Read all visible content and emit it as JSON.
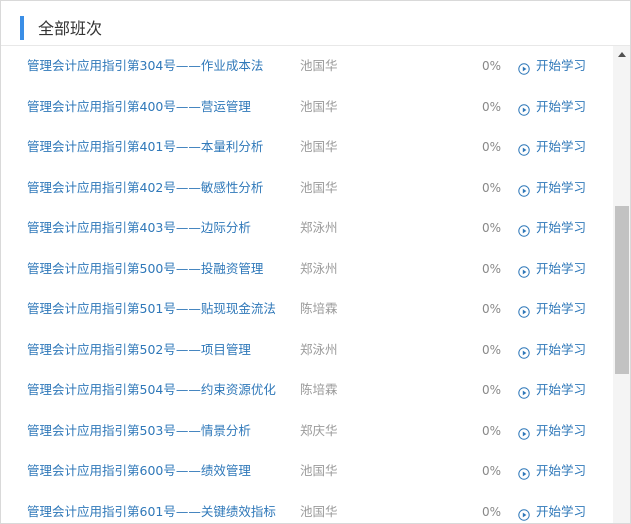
{
  "header": {
    "title": "全部班次"
  },
  "start_label": "开始学习",
  "courses": [
    {
      "name": "管理会计应用指引第304号——作业成本法",
      "teacher": "池国华",
      "progress": "0%"
    },
    {
      "name": "管理会计应用指引第400号——营运管理",
      "teacher": "池国华",
      "progress": "0%"
    },
    {
      "name": "管理会计应用指引第401号——本量利分析",
      "teacher": "池国华",
      "progress": "0%"
    },
    {
      "name": "管理会计应用指引第402号——敏感性分析",
      "teacher": "池国华",
      "progress": "0%"
    },
    {
      "name": "管理会计应用指引第403号——边际分析",
      "teacher": "郑泳州",
      "progress": "0%"
    },
    {
      "name": "管理会计应用指引第500号——投融资管理",
      "teacher": "郑泳州",
      "progress": "0%"
    },
    {
      "name": "管理会计应用指引第501号——贴现现金流法",
      "teacher": "陈培霖",
      "progress": "0%"
    },
    {
      "name": "管理会计应用指引第502号——项目管理",
      "teacher": "郑泳州",
      "progress": "0%"
    },
    {
      "name": "管理会计应用指引第504号——约束资源优化",
      "teacher": "陈培霖",
      "progress": "0%"
    },
    {
      "name": "管理会计应用指引第503号——情景分析",
      "teacher": "郑庆华",
      "progress": "0%"
    },
    {
      "name": "管理会计应用指引第600号——绩效管理",
      "teacher": "池国华",
      "progress": "0%"
    },
    {
      "name": "管理会计应用指引第601号——关键绩效指标",
      "teacher": "池国华",
      "progress": "0%"
    }
  ],
  "colors": {
    "accent": "#3a8ee6",
    "link": "#2f78b9",
    "muted": "#9a9a9a"
  },
  "icons": {
    "start": "play-circle-icon",
    "scroll_up": "scroll-up-arrow-icon"
  }
}
